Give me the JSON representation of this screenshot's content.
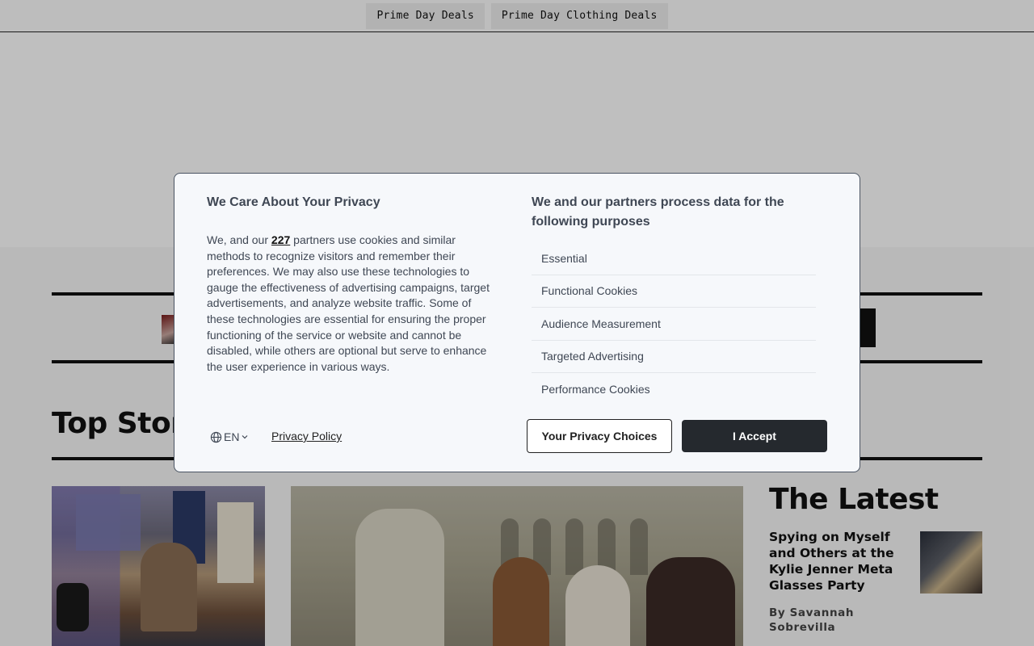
{
  "topbar": {
    "deals": [
      "Prime Day Deals",
      "Prime Day Clothing Deals"
    ]
  },
  "main": {
    "top_stories_heading": "Top Stori",
    "latest": {
      "heading": "The Latest",
      "item_title": "Spying on Myself and Others at the Kylie Jenner Meta Glasses Party",
      "item_byline": "By Savannah Sobrevilla"
    }
  },
  "consent": {
    "title": "We Care About Your Privacy",
    "text_before_link": "We, and our ",
    "partners_count": "227",
    "text_after_link": " partners use cookies and similar methods to recognize visitors and remember their preferences. We may also use these technologies to gauge the effectiveness of advertising campaigns, target advertisements, and analyze website traffic. Some of these technologies are essential for ensuring the proper functioning of the service or website and cannot be disabled, while others are optional but serve to enhance the user experience in various ways.",
    "purposes_title": "We and our partners process data for the following purposes",
    "purposes": [
      "Essential",
      "Functional Cookies",
      "Audience Measurement",
      "Targeted Advertising",
      "Performance Cookies"
    ],
    "language": "EN",
    "privacy_policy": "Privacy Policy",
    "choices_button": "Your Privacy Choices",
    "accept_button": "I Accept"
  },
  "icons": {
    "language": "globe-icon",
    "language_caret": "chevron-down-icon"
  },
  "colors": {
    "dialog_bg": "#f6f8fb",
    "dialog_text": "#3f4754",
    "accept_bg": "#25292e"
  }
}
